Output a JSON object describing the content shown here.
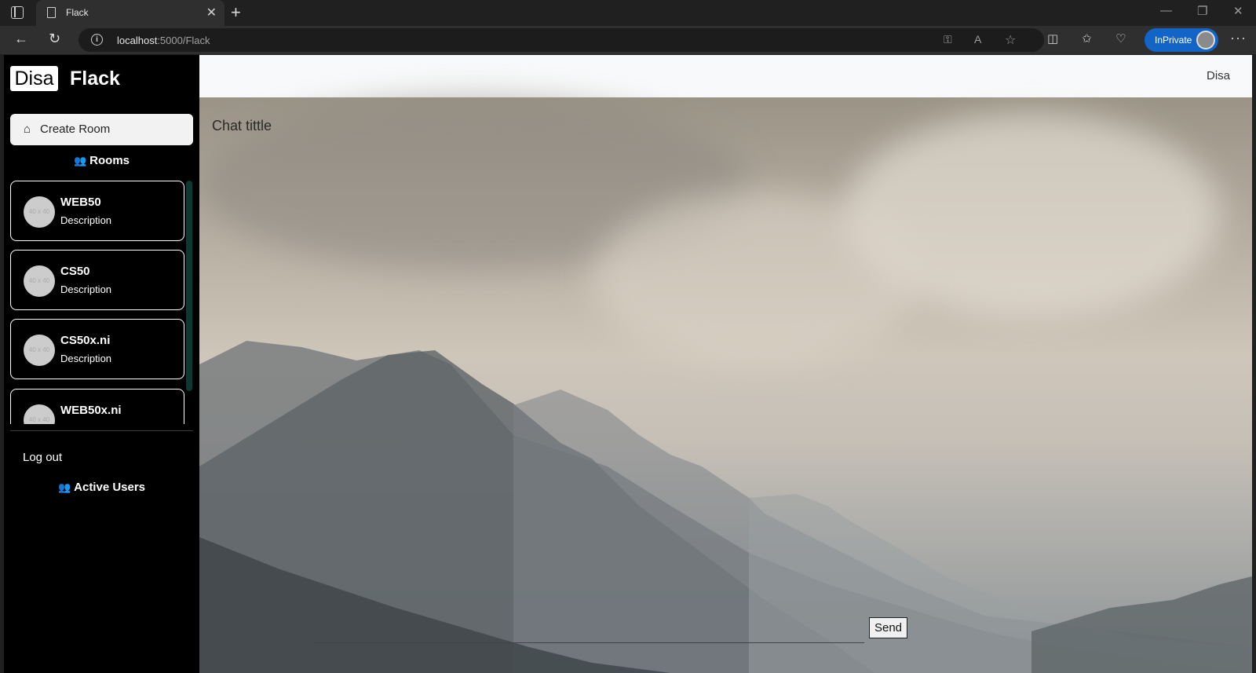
{
  "browser": {
    "tab_title": "Flack",
    "url_host": "localhost",
    "url_path": ":5000/Flack",
    "inprivate_label": "InPrivate"
  },
  "brand": {
    "short": "Disa",
    "name": "Flack"
  },
  "sidebar": {
    "create_room_label": "Create Room",
    "rooms_heading": "Rooms",
    "rooms": [
      {
        "name": "WEB50",
        "description": "Description",
        "thumb": "40 x 40"
      },
      {
        "name": "CS50",
        "description": "Description",
        "thumb": "40 x 40"
      },
      {
        "name": "CS50x.ni",
        "description": "Description",
        "thumb": "40 x 40"
      },
      {
        "name": "WEB50x.ni",
        "description": "",
        "thumb": "40 x 40"
      }
    ],
    "logout_label": "Log out",
    "active_users_heading": "Active Users"
  },
  "header": {
    "username": "Disa"
  },
  "chat": {
    "title": "Chat tittle",
    "send_label": "Send"
  },
  "icons": {
    "home": "home-icon",
    "group": "users-group-icon"
  },
  "colors": {
    "sidebar_bg": "#000000",
    "topbar_bg": "#f8f9fa",
    "inprivate": "#1265c7"
  }
}
